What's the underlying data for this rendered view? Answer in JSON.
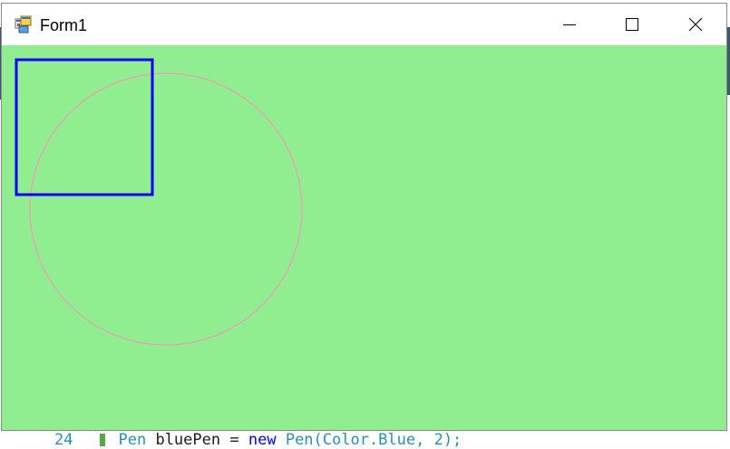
{
  "window": {
    "title": "Form1",
    "icon": "winforms-app-icon",
    "client_background": "#90ee90"
  },
  "caption_buttons": {
    "minimize_icon": "minimize-icon",
    "maximize_icon": "maximize-icon",
    "close_icon": "close-icon"
  },
  "drawing": {
    "rectangle": {
      "stroke": "#0000ff"
    },
    "circle": {
      "stroke": "#e8a0b4"
    }
  },
  "background_code": {
    "line_number": "24",
    "tokens": [
      "Pen",
      "bluePen",
      "=",
      "new",
      "Pen(Color.Blue, 2);"
    ]
  }
}
